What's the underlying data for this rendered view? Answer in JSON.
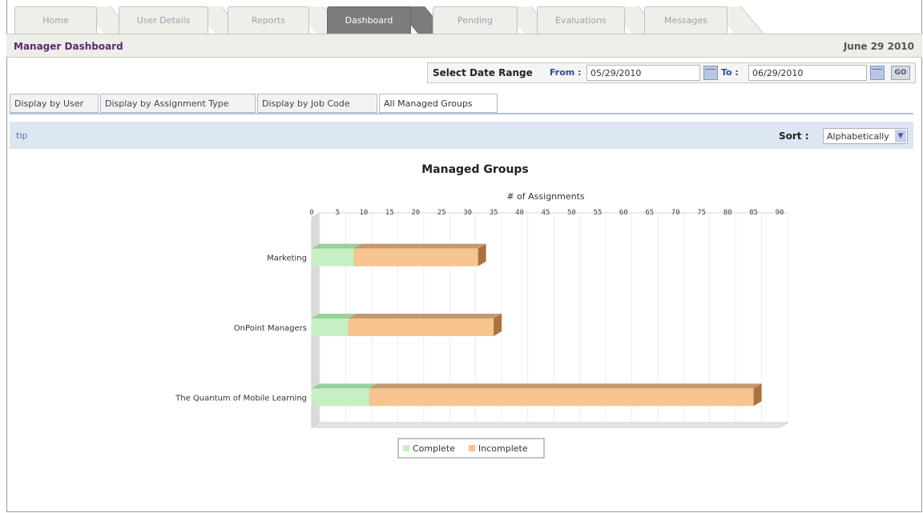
{
  "tabs": [
    {
      "label": "Home"
    },
    {
      "label": "User Details"
    },
    {
      "label": "Reports"
    },
    {
      "label": "Dashboard"
    },
    {
      "label": "Pending"
    },
    {
      "label": "Evaluations"
    },
    {
      "label": "Messages"
    }
  ],
  "header": {
    "title": "Manager Dashboard",
    "date": "June 29 2010"
  },
  "date_range": {
    "label": "Select Date Range",
    "from_label": "From :",
    "from_value": "05/29/2010",
    "to_label": "To :",
    "to_value": "06/29/2010",
    "go_label": "GO"
  },
  "subtabs": [
    {
      "label": "Display by User"
    },
    {
      "label": "Display by Assignment Type"
    },
    {
      "label": "Display by Job Code"
    },
    {
      "label": "All Managed Groups"
    }
  ],
  "tipbar": {
    "tip": "tip",
    "sort_label": "Sort :",
    "sort_value": "Alphabetically"
  },
  "chart_data": {
    "type": "bar",
    "orientation": "horizontal",
    "stacked": true,
    "title": "Managed Groups",
    "xlabel": "# of Assignments",
    "xlim": [
      0,
      90
    ],
    "xticks": [
      0,
      5,
      10,
      15,
      20,
      25,
      30,
      35,
      40,
      45,
      50,
      55,
      60,
      65,
      70,
      75,
      80,
      85,
      90
    ],
    "categories": [
      "Marketing",
      "OnPoint Managers",
      "The Quantum of Mobile Learning"
    ],
    "series": [
      {
        "name": "Complete",
        "values": [
          8,
          7,
          11
        ],
        "color": "#c7efc4"
      },
      {
        "name": "Incomplete",
        "values": [
          24,
          28,
          74
        ],
        "color": "#f7c48f"
      }
    ],
    "legend_position": "bottom",
    "grid": true
  }
}
